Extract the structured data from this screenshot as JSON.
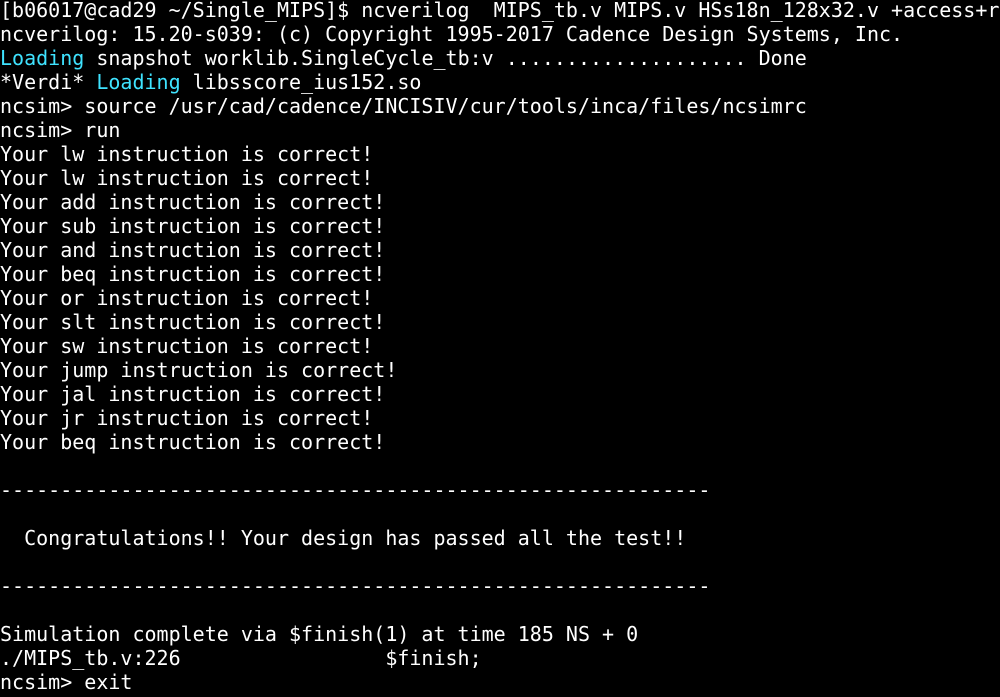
{
  "terminal": {
    "colors": {
      "background": "#000000",
      "foreground": "#ffffff",
      "highlight": "#3fe3ff"
    },
    "lines": [
      {
        "pre": "[b06017@cad29 ~/Single_MIPS]$ ncverilog  MIPS_tb.v MIPS.v HSs18n_128x32.v +access+r",
        "hl": "",
        "post": ""
      },
      {
        "pre": "ncverilog: 15.20-s039: (c) Copyright 1995-2017 Cadence Design Systems, Inc.",
        "hl": "",
        "post": ""
      },
      {
        "pre": "",
        "hl": "Loading",
        "post": " snapshot worklib.SingleCycle_tb:v .................... Done"
      },
      {
        "pre": "*Verdi* ",
        "hl": "Loading",
        "post": " libsscore_ius152.so"
      },
      {
        "pre": "ncsim> source /usr/cad/cadence/INCISIV/cur/tools/inca/files/ncsimrc",
        "hl": "",
        "post": ""
      },
      {
        "pre": "ncsim> run",
        "hl": "",
        "post": ""
      },
      {
        "pre": "Your lw instruction is correct!",
        "hl": "",
        "post": ""
      },
      {
        "pre": "Your lw instruction is correct!",
        "hl": "",
        "post": ""
      },
      {
        "pre": "Your add instruction is correct!",
        "hl": "",
        "post": ""
      },
      {
        "pre": "Your sub instruction is correct!",
        "hl": "",
        "post": ""
      },
      {
        "pre": "Your and instruction is correct!",
        "hl": "",
        "post": ""
      },
      {
        "pre": "Your beq instruction is correct!",
        "hl": "",
        "post": ""
      },
      {
        "pre": "Your or instruction is correct!",
        "hl": "",
        "post": ""
      },
      {
        "pre": "Your slt instruction is correct!",
        "hl": "",
        "post": ""
      },
      {
        "pre": "Your sw instruction is correct!",
        "hl": "",
        "post": ""
      },
      {
        "pre": "Your jump instruction is correct!",
        "hl": "",
        "post": ""
      },
      {
        "pre": "Your jal instruction is correct!",
        "hl": "",
        "post": ""
      },
      {
        "pre": "Your jr instruction is correct!",
        "hl": "",
        "post": ""
      },
      {
        "pre": "Your beq instruction is correct!",
        "hl": "",
        "post": ""
      },
      {
        "pre": "",
        "hl": "",
        "post": ""
      },
      {
        "pre": "-----------------------------------------------------------",
        "hl": "",
        "post": ""
      },
      {
        "pre": "",
        "hl": "",
        "post": ""
      },
      {
        "pre": "  Congratulations!! Your design has passed all the test!!",
        "hl": "",
        "post": ""
      },
      {
        "pre": "",
        "hl": "",
        "post": ""
      },
      {
        "pre": "-----------------------------------------------------------",
        "hl": "",
        "post": ""
      },
      {
        "pre": "",
        "hl": "",
        "post": ""
      },
      {
        "pre": "Simulation complete via $finish(1) at time 185 NS + 0",
        "hl": "",
        "post": ""
      },
      {
        "pre": "./MIPS_tb.v:226                 $finish;",
        "hl": "",
        "post": ""
      },
      {
        "pre": "ncsim> exit",
        "hl": "",
        "post": ""
      }
    ]
  }
}
